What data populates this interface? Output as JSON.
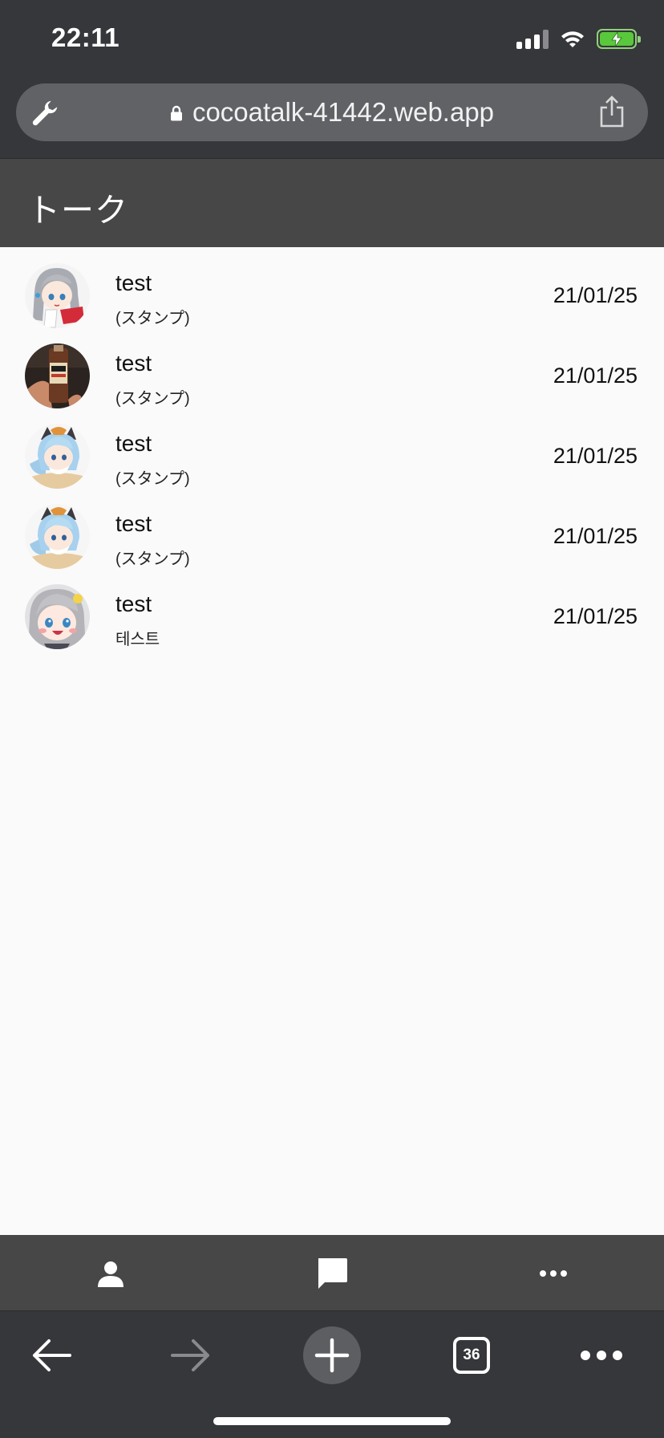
{
  "status_bar": {
    "time": "22:11"
  },
  "browser": {
    "url": "cocoatalk-41442.web.app",
    "tab_count": "36"
  },
  "app": {
    "title": "トーク",
    "talks": [
      {
        "name": "test",
        "last_message": "(スタンプ)",
        "date": "21/01/25",
        "avatar": "anime-girl-silver-hair-avatar"
      },
      {
        "name": "test",
        "last_message": "(スタンプ)",
        "date": "21/01/25",
        "avatar": "drink-bottle-photo-avatar"
      },
      {
        "name": "test",
        "last_message": "(スタンプ)",
        "date": "21/01/25",
        "avatar": "anime-girl-blue-hair-cat-ears-avatar"
      },
      {
        "name": "test",
        "last_message": "(スタンプ)",
        "date": "21/01/25",
        "avatar": "anime-girl-blue-hair-cat-ears-avatar"
      },
      {
        "name": "test",
        "last_message": "테스트",
        "date": "21/01/25",
        "avatar": "anime-girl-gray-hair-chibi-avatar"
      }
    ],
    "nav": [
      {
        "icon": "person-icon"
      },
      {
        "icon": "chat-bubble-icon"
      },
      {
        "icon": "more-horizontal-icon"
      }
    ]
  },
  "colors": {
    "chrome": "#36373a",
    "app_bar": "#474747",
    "list_bg": "#fafafa",
    "battery": "#5ac83c"
  }
}
